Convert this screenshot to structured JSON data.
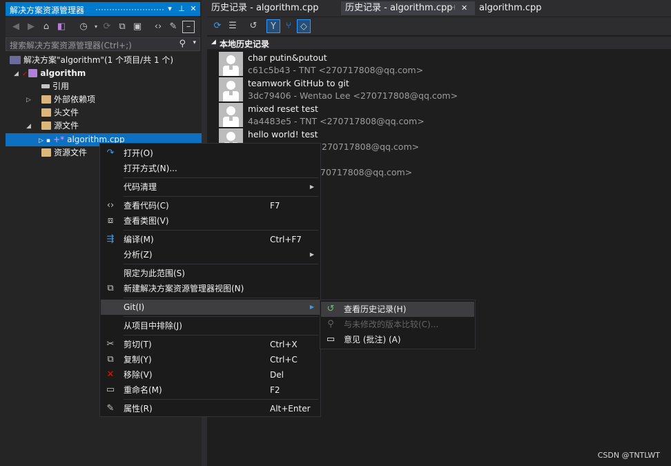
{
  "solution_explorer": {
    "title": "解决方案资源管理器",
    "search_placeholder": "搜索解决方案资源管理器(Ctrl+;)",
    "tree": {
      "solution": "解决方案\"algorithm\"(1 个项目/共 1 个)",
      "project": "algorithm",
      "references": "引用",
      "external_deps": "外部依赖项",
      "header_files": "头文件",
      "source_files": "源文件",
      "selected_file": "algorithm.cpp",
      "resource_files": "资源文件"
    }
  },
  "tabs": [
    {
      "label": "历史记录 - algorithm.cpp"
    },
    {
      "label": "历史记录 - algorithm.cpp"
    },
    {
      "label": "algorithm.cpp"
    }
  ],
  "history": {
    "section_title": "本地历史记录",
    "commits": [
      {
        "message": "char putin&putout",
        "meta": "c61c5b43 - TNT <270717808@qq.com>"
      },
      {
        "message": "teamwork GitHub to git",
        "meta": "3dc79406 - Wentao Lee <270717808@qq.com>"
      },
      {
        "message": "mixed reset test",
        "meta": "4a4483e5 - TNT <270717808@qq.com>"
      },
      {
        "message": "hello world! test",
        "meta": "270717808@qq.com>"
      },
      {
        "message": "",
        "meta": "70717808@qq.com>"
      }
    ]
  },
  "context_menu": {
    "open": "打开(O)",
    "open_with": "打开方式(N)...",
    "code_cleanup": "代码清理",
    "view_code": "查看代码(C)",
    "view_code_shortcut": "F7",
    "view_class_diagram": "查看类图(V)",
    "compile": "编译(M)",
    "compile_shortcut": "Ctrl+F7",
    "analyze": "分析(Z)",
    "scope_to_this": "限定为此范围(S)",
    "new_explorer_view": "新建解决方案资源管理器视图(N)",
    "git": "Git(I)",
    "exclude": "从项目中排除(J)",
    "cut": "剪切(T)",
    "cut_shortcut": "Ctrl+X",
    "copy": "复制(Y)",
    "copy_shortcut": "Ctrl+C",
    "remove": "移除(V)",
    "remove_shortcut": "Del",
    "rename": "重命名(M)",
    "rename_shortcut": "F2",
    "properties": "属性(R)",
    "properties_shortcut": "Alt+Enter"
  },
  "git_submenu": {
    "view_history": "查看历史记录(H)",
    "compare_unmodified": "与未修改的版本比较(C)...",
    "blame": "意见 (批注) (A)"
  },
  "watermark": "CSDN @TNTLWT",
  "colors": {
    "accent": "#007acc",
    "selection": "#0e70c0",
    "background": "#1e1e1e"
  }
}
